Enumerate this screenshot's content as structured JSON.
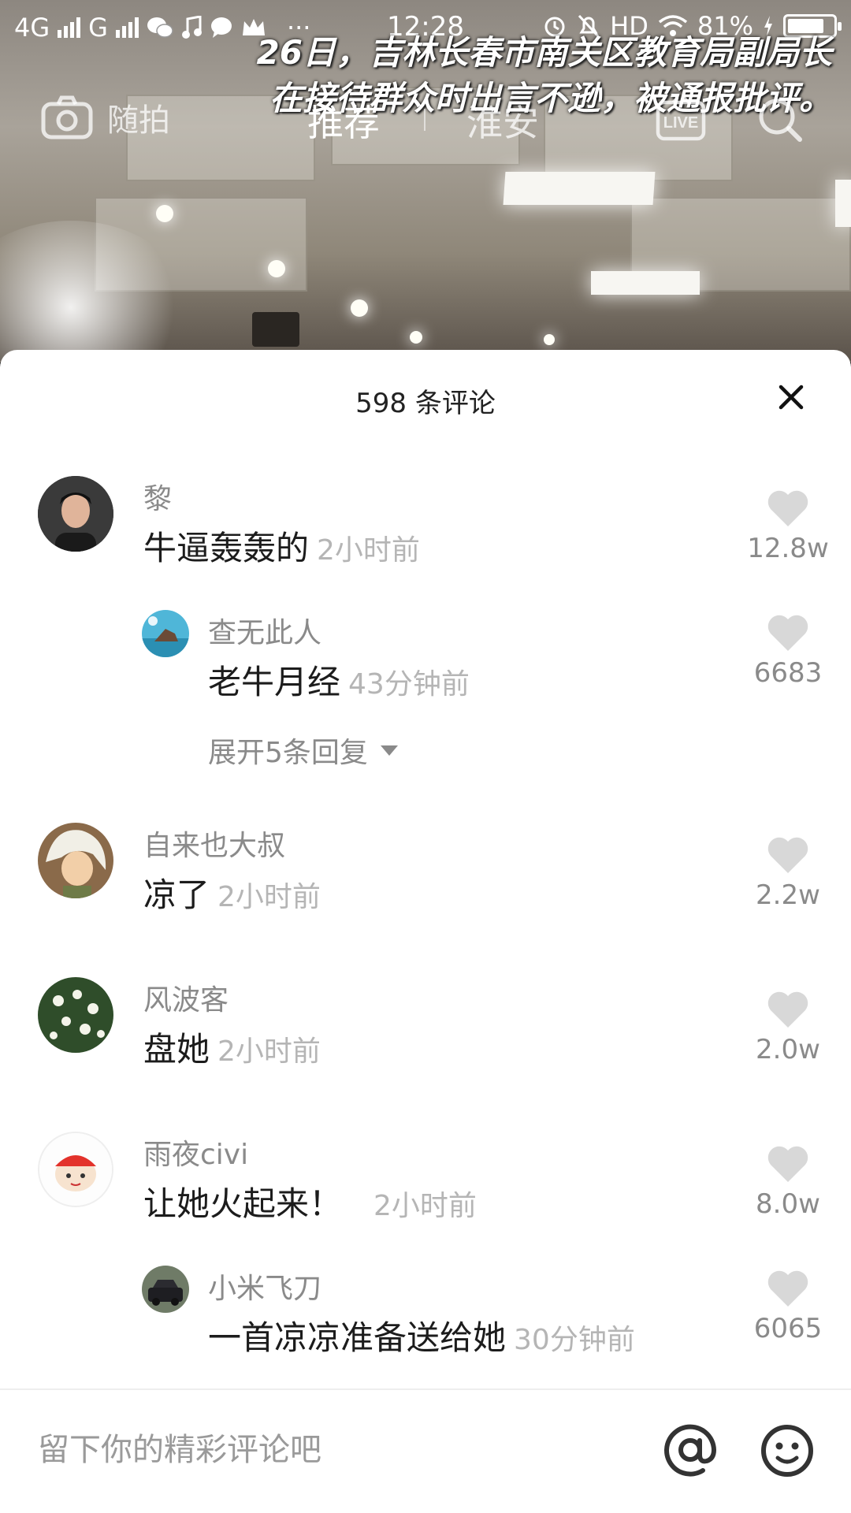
{
  "status_bar": {
    "net1": "4G",
    "net2": "G",
    "more": "···",
    "time": "12:28",
    "hd": "HD",
    "battery_text": "81%",
    "battery_level": 0.81
  },
  "video": {
    "caption_line1": "26日，吉林长春市南关区教育局副局长",
    "caption_line2": "在接待群众时出言不逊，被通报批评。"
  },
  "top_nav": {
    "camera_label": "随拍",
    "tabs": [
      {
        "label": "推荐",
        "active": true
      },
      {
        "label": "淮安",
        "active": false
      }
    ],
    "live_label": "LIVE"
  },
  "comments_sheet": {
    "title": "598 条评论",
    "comments": [
      {
        "name": "黎",
        "text": "牛逼轰轰的",
        "time": "2小时前",
        "likes": "12.8w",
        "avatar": "person-photo"
      },
      {
        "name": "查无此人",
        "text": "老牛月经",
        "time": "43分钟前",
        "likes": "6683",
        "avatar": "seaside-photo",
        "reply": true
      },
      {
        "name": "自来也大叔",
        "text": "凉了",
        "time": "2小时前",
        "likes": "2.2w",
        "avatar": "anime-character"
      },
      {
        "name": "风波客",
        "text": "盘她",
        "time": "2小时前",
        "likes": "2.0w",
        "avatar": "flowers-photo"
      },
      {
        "name": "雨夜civi",
        "text": "让她火起来！",
        "time": "2小时前",
        "likes": "8.0w",
        "avatar": "cartoon-face"
      },
      {
        "name": "小米飞刀",
        "text": "一首凉凉准备送给她",
        "time": "30分钟前",
        "likes": "6065",
        "avatar": "car-photo",
        "reply": true
      }
    ],
    "expand_replies": "展开5条回复"
  },
  "input": {
    "placeholder": "留下你的精彩评论吧",
    "value": ""
  },
  "colors": {
    "sheet_bg": "#ffffff",
    "name_gray": "#8a8a8a",
    "time_gray": "#b5b5b5",
    "heart_gray": "#d8d8d8"
  }
}
